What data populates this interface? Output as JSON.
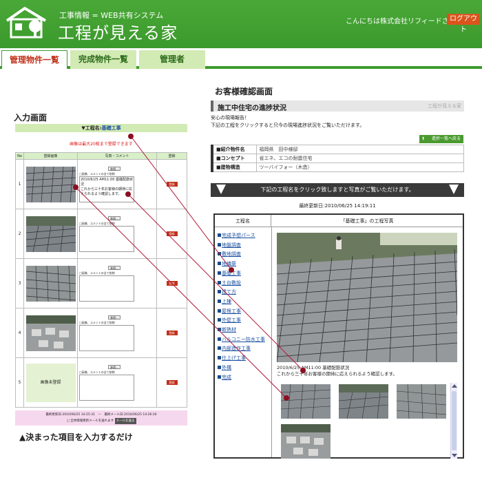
{
  "header": {
    "subtitle": "工事情報 = WEB共有システム",
    "title": "工程が見える家",
    "greeting": "こんにちは株式会社リフィードさん",
    "logout": "ログアウト"
  },
  "tabs": [
    {
      "label": "管理物件一覧",
      "active": true
    },
    {
      "label": "完成物件一覧",
      "active": false
    },
    {
      "label": "管理者",
      "active": false
    }
  ],
  "captions": {
    "input_screen": "入力画面",
    "customer_screen": "お客様確認画面",
    "bottom": "▲決まった項目を入力するだけ"
  },
  "form": {
    "stage_prefix": "▼工程名:",
    "stage_name": "基礎工事",
    "note": "画像は最大20枚まで登録できます",
    "headers": [
      "No",
      "登録画像",
      "写真・コメント",
      "登録"
    ],
    "ref_label": "参照...",
    "checkbox_label": "□画像、コメントの全て削除",
    "register_label": "登録",
    "no_image": "画像未登録",
    "rows": [
      {
        "no": "1",
        "comment": "2010/6/25 AM11:00 基礎配筋状況\nこれから三十年お客様の期待に応えられるよう確認します。"
      },
      {
        "no": "2",
        "comment": ""
      },
      {
        "no": "3",
        "comment": ""
      },
      {
        "no": "4",
        "comment": ""
      },
      {
        "no": "5",
        "comment": ""
      }
    ],
    "footer_updated": "最終更新日:2010/06/25 14:25:31　—　最終メール日:2010/06/25 14:26:26",
    "footer_mail_check": "□ 全体情報更新メールを送れます",
    "footer_mail_button": "メールを送る"
  },
  "customer": {
    "section_title": "施工中住宅の進捗状況",
    "section_logo": "工程が見える家",
    "intro1": "安心の現場報告！",
    "intro2": "下記の工程をクリックすると只今の現場進捗状況をご覧いただけます。",
    "back_button": "進捗一覧へ戻る",
    "props": [
      {
        "k": "■紹介物件名",
        "v": "福岡県　田中様邸"
      },
      {
        "k": "■コンセプト",
        "v": "省エネ、エコの耐震住宅"
      },
      {
        "k": "■建物構造",
        "v": "ツーバイフォー（木造）"
      }
    ],
    "banner": "下記の工程名をクリック致しますと写真がご覧いただけます。",
    "updated": "最終更新日:2010/06/25 14:19:11",
    "col_stage": "工程名",
    "col_photo": "「基礎工事」の工程写真",
    "stages": [
      "完成予想パース",
      "地盤調査",
      "敷地調査",
      "地鎮祭",
      "基礎工事",
      "土台敷設",
      "建て方",
      "上棟",
      "屋根工事",
      "外壁工事",
      "断熱材",
      "バルコニー防水工事",
      "内部造作工事",
      "仕上げ工事",
      "外構",
      "完成"
    ],
    "photo_caption1": "2010/6/25 AM11:00 基礎配筋状況",
    "photo_caption2": "これから三十年お客様の期待に応えられるよう確認します。"
  }
}
